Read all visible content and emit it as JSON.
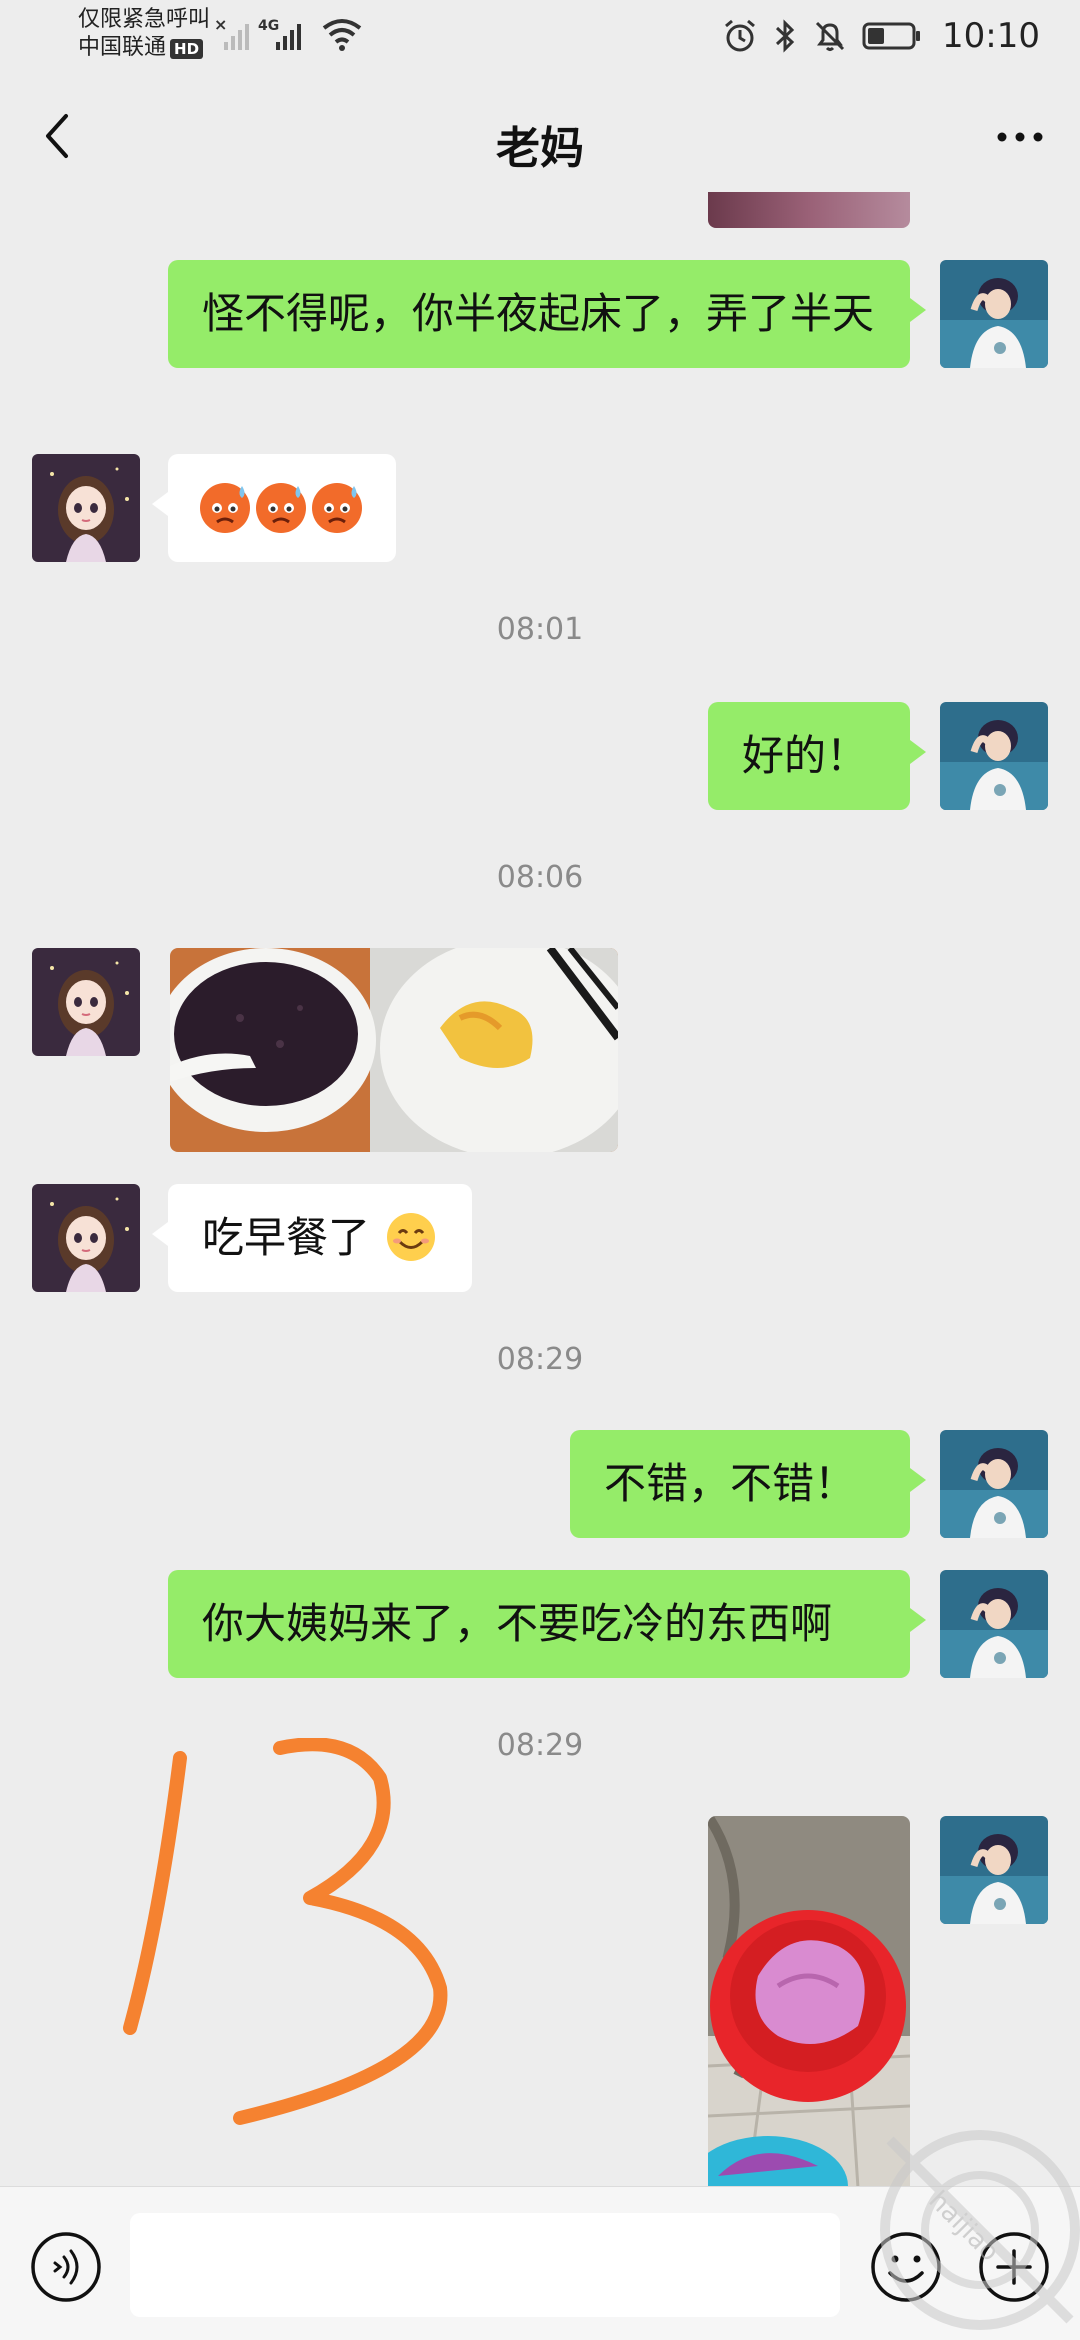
{
  "status_bar": {
    "carrier_line1": "仅限紧急呼叫",
    "carrier_line2": "中国联通",
    "hd_badge": "HD",
    "network": "4G",
    "time": "10:10"
  },
  "header": {
    "title": "老妈"
  },
  "messages": [
    {
      "sender": "me",
      "text": "怪不得呢，你半夜起床了，弄了半天"
    },
    {
      "sender": "them",
      "type": "emoji",
      "emojis": [
        "cold-sweat-emoji",
        "cold-sweat-emoji",
        "cold-sweat-emoji"
      ]
    },
    {
      "type": "timestamp",
      "text": "08:01"
    },
    {
      "sender": "me",
      "text": "好的！"
    },
    {
      "type": "timestamp",
      "text": "08:06"
    },
    {
      "sender": "them",
      "type": "image",
      "image": "breakfast-porridge-egg-photo"
    },
    {
      "sender": "them",
      "text": "吃早餐了",
      "trailing_emoji": "smile-emoji"
    },
    {
      "type": "timestamp",
      "text": "08:29"
    },
    {
      "sender": "me",
      "text": "不错，不错！"
    },
    {
      "sender": "me",
      "text": "你大姨妈来了，不要吃冷的东西啊"
    },
    {
      "type": "timestamp",
      "text": "08:29"
    },
    {
      "sender": "me",
      "type": "image",
      "image": "red-basin-laundry-photo"
    }
  ],
  "annotation": "13",
  "watermark": "haijiao",
  "colors": {
    "my_bubble": "#95ec69",
    "their_bubble": "#ffffff",
    "background": "#ededed",
    "annotation": "#f58230"
  }
}
